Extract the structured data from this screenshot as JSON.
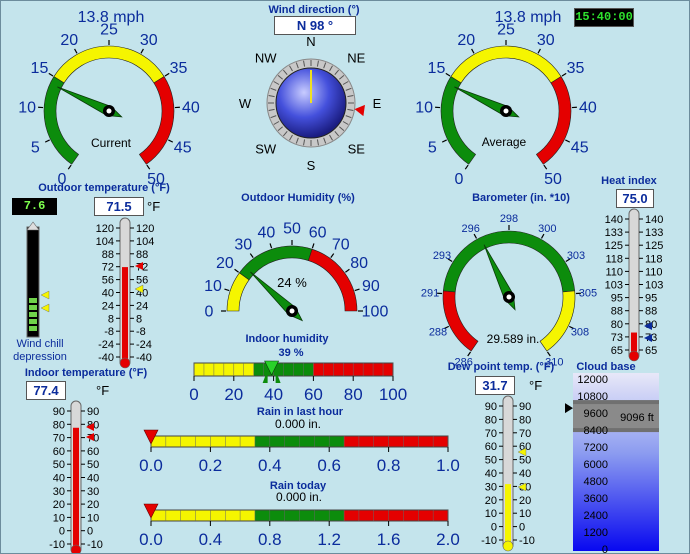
{
  "clock": "15:40:00",
  "wind_current": {
    "speed_text": "13.8 mph",
    "label": "Current",
    "value": 13.8,
    "ticks": [
      "0",
      "5",
      "10",
      "15",
      "20",
      "25",
      "30",
      "35",
      "40",
      "45",
      "50"
    ]
  },
  "wind_average": {
    "speed_text": "13.8 mph",
    "label": "Average",
    "value": 13.8,
    "ticks": [
      "0",
      "5",
      "10",
      "15",
      "20",
      "25",
      "30",
      "35",
      "40",
      "45",
      "50"
    ]
  },
  "wind_direction": {
    "title": "Wind direction (°)",
    "readout": "N   98 °",
    "degrees": 98,
    "compass": [
      "N",
      "NE",
      "E",
      "SE",
      "S",
      "SW",
      "W",
      "NW"
    ]
  },
  "wind_chill": {
    "value": "7.6",
    "label_line1": "Wind chill",
    "label_line2": "depression"
  },
  "outdoor_temp": {
    "title": "Outdoor temperature (°F)",
    "value": "71.5",
    "unit": "°F",
    "ticks": [
      "120",
      "104",
      "88",
      "72",
      "56",
      "40",
      "24",
      "8",
      "-8",
      "-24",
      "-40"
    ],
    "level": 71.5
  },
  "outdoor_humidity": {
    "title": "Outdoor Humidity (%)",
    "value_text": "24 %",
    "value": 24,
    "ticks": [
      "0",
      "10",
      "20",
      "30",
      "40",
      "50",
      "60",
      "70",
      "80",
      "90",
      "100"
    ]
  },
  "barometer": {
    "title": "Barometer (in. *10)",
    "value_text": "29.589 in.",
    "value": 295.89,
    "ticks": [
      "286",
      "288",
      "291",
      "293",
      "296",
      "298",
      "300",
      "303",
      "305",
      "308",
      "310"
    ]
  },
  "heat_index": {
    "title": "Heat index",
    "value": "75.0",
    "ticks": [
      "140",
      "133",
      "125",
      "118",
      "110",
      "103",
      "95",
      "88",
      "80",
      "73",
      "65"
    ],
    "level": 75.0
  },
  "indoor_temp": {
    "title": "Indoor temperature (°F)",
    "value": "77.4",
    "unit": "°F",
    "ticks": [
      "90",
      "80",
      "70",
      "60",
      "50",
      "40",
      "30",
      "20",
      "10",
      "0",
      "-10"
    ],
    "level": 77.4
  },
  "indoor_humidity": {
    "title": "Indoor humidity",
    "value_text": "39 %",
    "value": 39,
    "ticks": [
      "0",
      "20",
      "40",
      "60",
      "80",
      "100"
    ]
  },
  "rain_hour": {
    "title": "Rain in last hour",
    "value_text": "0.000 in.",
    "value": 0,
    "ticks": [
      "0.0",
      "0.2",
      "0.4",
      "0.6",
      "0.8",
      "1.0"
    ]
  },
  "rain_today": {
    "title": "Rain today",
    "value_text": "0.000 in.",
    "value": 0,
    "ticks": [
      "0.0",
      "0.4",
      "0.8",
      "1.2",
      "1.6",
      "2.0"
    ]
  },
  "dew_point": {
    "title": "Dew point temp. (°F)",
    "value": "31.7",
    "unit": "°F",
    "ticks": [
      "90",
      "80",
      "70",
      "60",
      "50",
      "40",
      "30",
      "20",
      "10",
      "0",
      "-10"
    ],
    "level": 31.7
  },
  "cloud_base": {
    "title": "Cloud base",
    "value_text": "9096 ft",
    "value": 9096,
    "ticks": [
      "12000",
      "10800",
      "9600",
      "8400",
      "7200",
      "6000",
      "4800",
      "3600",
      "2400",
      "1200",
      "0"
    ]
  },
  "colors": {
    "red": "#e40000",
    "yellow": "#f5f500",
    "green": "#0c8c0c",
    "navy": "#0b2c9c",
    "panel": "#c4e4ec"
  }
}
